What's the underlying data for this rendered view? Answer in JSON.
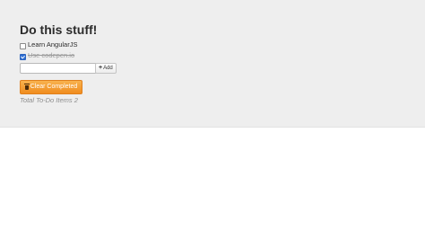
{
  "header": {
    "title": "Do this stuff!"
  },
  "todos": [
    {
      "text": "Learn AngularJS",
      "done": false
    },
    {
      "text": "Use codepen.io",
      "done": true
    }
  ],
  "new_todo": {
    "value": "",
    "placeholder": ""
  },
  "buttons": {
    "add_label": "Add",
    "clear_label": "Clear Completed"
  },
  "footer": {
    "total_label": "Total To-Do Items",
    "total_count": "2"
  },
  "colors": {
    "panel_bg": "#eeeeee",
    "accent_orange": "#f08c1e",
    "checkbox_blue": "#2e6fd4"
  },
  "icons": {
    "add": "plus-icon",
    "clear": "trash-icon"
  }
}
